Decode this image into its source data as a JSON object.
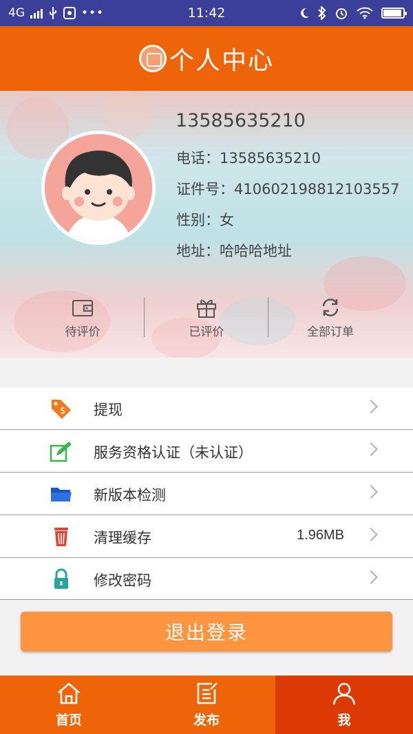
{
  "status_bar": {
    "network": "4G",
    "time": "11:42"
  },
  "header": {
    "title": "个人中心"
  },
  "profile": {
    "username": "13585635210",
    "phone": "电话：13585635210",
    "id_number": "证件号：410602198812103557",
    "gender": "性别：女",
    "address": "地址：哈哈哈地址"
  },
  "actions": [
    {
      "label": "待评价",
      "icon": "wallet-icon"
    },
    {
      "label": "已评价",
      "icon": "gift-icon"
    },
    {
      "label": "全部订单",
      "icon": "refresh-icon"
    }
  ],
  "menu": [
    {
      "label": "提现",
      "value": "",
      "icon": "price-tag-icon"
    },
    {
      "label": "服务资格认证（未认证）",
      "value": "",
      "icon": "edit-icon"
    },
    {
      "label": "新版本检测",
      "value": "",
      "icon": "folder-icon"
    },
    {
      "label": "清理缓存",
      "value": "1.96MB",
      "icon": "trash-icon"
    },
    {
      "label": "修改密码",
      "value": "",
      "icon": "lock-icon"
    }
  ],
  "logout_label": "退出登录",
  "tabs": [
    {
      "label": "首页",
      "icon": "home-icon",
      "active": false
    },
    {
      "label": "发布",
      "icon": "publish-icon",
      "active": false
    },
    {
      "label": "我",
      "icon": "user-icon",
      "active": true
    }
  ],
  "colors": {
    "brand_orange": "#ee6409",
    "active_tab": "#dc3a04",
    "logout_button": "#ff9441",
    "status_bar": "#3b3f9a"
  }
}
